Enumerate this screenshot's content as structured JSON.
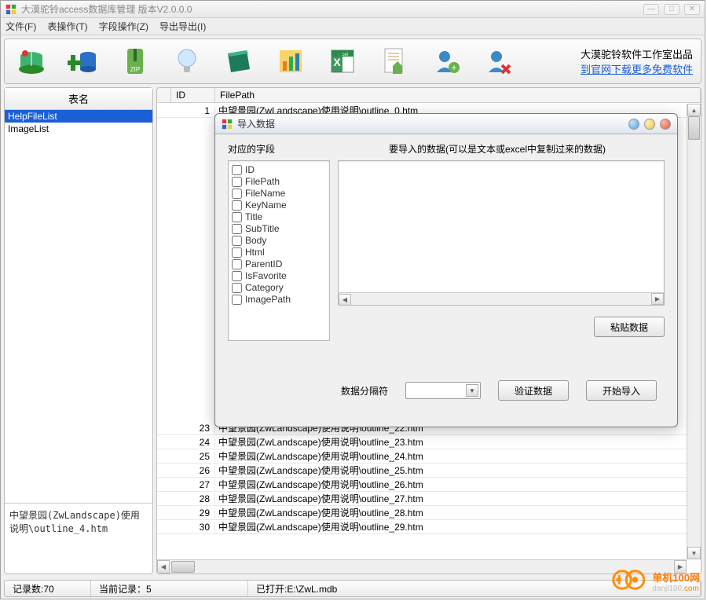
{
  "window": {
    "title": "大漠驼铃access数据库管理 版本V2.0.0.0"
  },
  "menus": [
    "文件(F)",
    "表操作(T)",
    "字段操作(Z)",
    "导出导出(I)"
  ],
  "promo": {
    "line1": "大漠驼铃软件工作室出品",
    "link": "到官网下载更多免费软件"
  },
  "sidebar": {
    "header": "表名",
    "tables": [
      {
        "name": "HelpFileList",
        "selected": true
      },
      {
        "name": "ImageList",
        "selected": false
      }
    ],
    "description": "中望景园(ZwLandscape)使用说明\\outline_4.htm"
  },
  "grid": {
    "columns": [
      "ID",
      "FilePath"
    ],
    "top_row": {
      "id": "1",
      "path": "中望景园(ZwLandscape)使用说明\\outline_0.htm"
    },
    "rows": [
      {
        "id": "23",
        "path": "中望景园(ZwLandscape)使用说明\\outline_22.htm"
      },
      {
        "id": "24",
        "path": "中望景园(ZwLandscape)使用说明\\outline_23.htm"
      },
      {
        "id": "25",
        "path": "中望景园(ZwLandscape)使用说明\\outline_24.htm"
      },
      {
        "id": "26",
        "path": "中望景园(ZwLandscape)使用说明\\outline_25.htm"
      },
      {
        "id": "27",
        "path": "中望景园(ZwLandscape)使用说明\\outline_26.htm"
      },
      {
        "id": "28",
        "path": "中望景园(ZwLandscape)使用说明\\outline_27.htm"
      },
      {
        "id": "29",
        "path": "中望景园(ZwLandscape)使用说明\\outline_28.htm"
      },
      {
        "id": "30",
        "path": "中望景园(ZwLandscape)使用说明\\outline_29.htm"
      }
    ]
  },
  "status": {
    "count": "记录数:70",
    "current": "当前记录：5",
    "opened": "已打开:E:\\ZwL.mdb"
  },
  "dialog": {
    "title": "导入数据",
    "left_header": "对应的字段",
    "right_header": "要导入的数据(可以是文本或excel中复制过来的数据)",
    "fields": [
      "ID",
      "FilePath",
      "FileName",
      "KeyName",
      "Title",
      "SubTitle",
      "Body",
      "Html",
      "ParentID",
      "IsFavorite",
      "Category",
      "ImagePath"
    ],
    "paste_btn": "粘贴数据",
    "sep_label": "数据分隔符",
    "verify_btn": "验证数据",
    "start_btn": "开始导入"
  },
  "watermark": {
    "line1": "单机100网",
    "line2_a": "danji100",
    "line2_b": ".com"
  }
}
